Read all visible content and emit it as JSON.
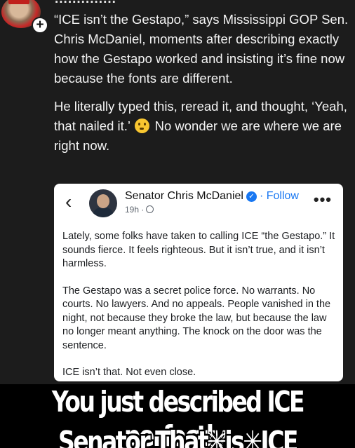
{
  "reply": {
    "cut_off_text": "..............",
    "paragraph_1": "“ICE isn’t the Gestapo,” says Mississippi GOP Sen. Chris McDaniel, moments after describing exactly how the Gestapo worked and insisting it’s fine now because the fonts are different.",
    "paragraph_2_a": "He literally typed this, reread it, and thought, ‘Yeah, that nailed it.’",
    "emoji_icon": "flushed-face-emoji",
    "paragraph_2_b": "No wonder we are where we are right now.",
    "follow_badge": "+"
  },
  "embedded_post": {
    "back_icon": "‹",
    "author": "Senator Chris McDaniel",
    "verified_icon": "verified-badge",
    "follow_label": "· Follow",
    "time": "19h ·",
    "privacy_icon": "globe-icon",
    "more_icon": "•••",
    "paragraphs": [
      "Lately, some folks have taken to calling ICE “the Gestapo.”  It sounds fierce.  It feels righteous.  But it isn’t true, and it isn’t harmless.",
      "The Gestapo was a secret police force.  No warrants.  No courts.  No lawyers.  And no appeals.  People vanished in the night, not because they broke the law, but because the law no longer meant anything.  The knock on the door was the sentence.",
      "ICE isn’t that.  Not even close."
    ]
  },
  "caption": {
    "line_1": "You just described ICE perfectly,",
    "line_2": "Senator That✳is✳ICE"
  },
  "colors": {
    "background": "#1c1c1c",
    "card": "#ffffff",
    "link_blue": "#1877f2",
    "caption_band": "#000000"
  }
}
